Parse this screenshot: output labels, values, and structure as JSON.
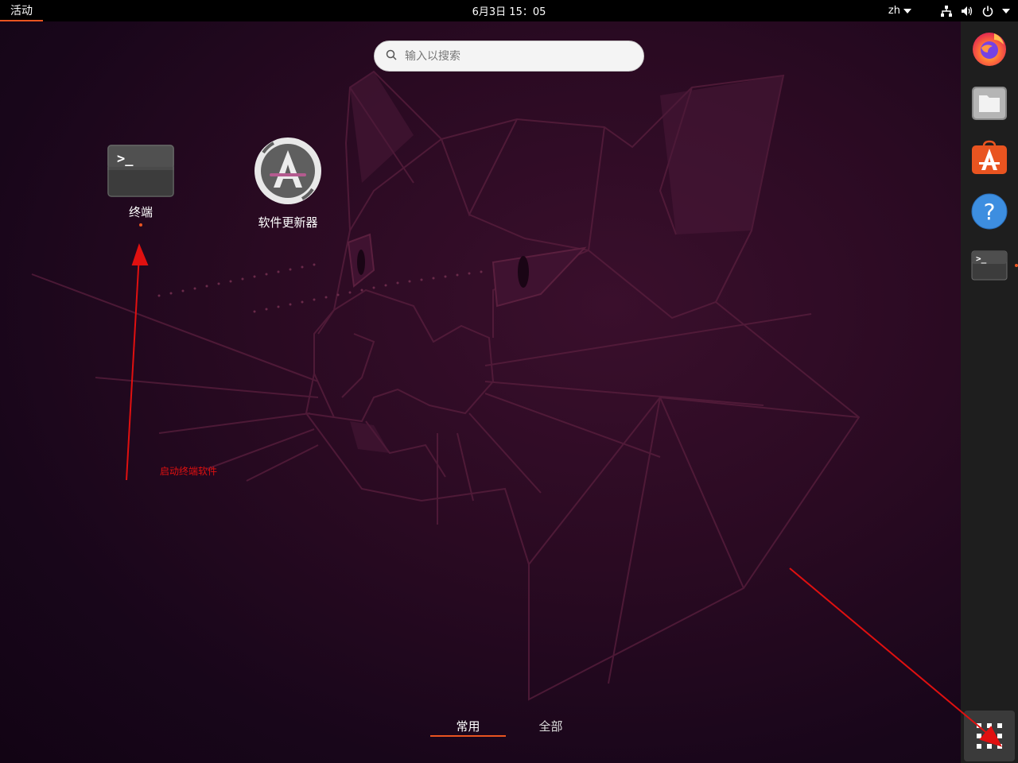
{
  "topbar": {
    "activities": "活动",
    "clock": "6月3日  15：05",
    "lang": "zh"
  },
  "search": {
    "placeholder": "输入以搜索"
  },
  "apps": [
    {
      "label": "终端"
    },
    {
      "label": "软件更新器"
    }
  ],
  "tabs": {
    "frequent": "常用",
    "all": "全部"
  },
  "annotation": {
    "text": "启动终端软件"
  },
  "colors": {
    "accent": "#e95420",
    "annotation": "#e01010"
  }
}
